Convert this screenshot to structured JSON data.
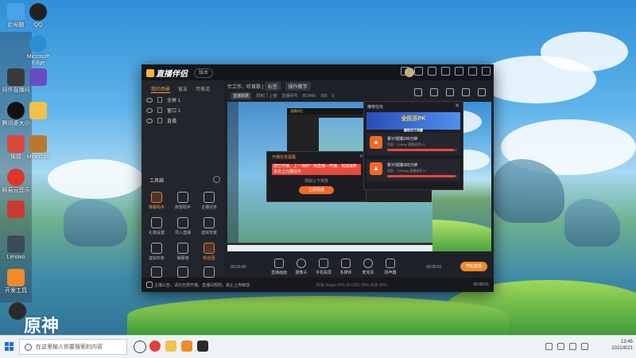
{
  "desktop": {
    "icons": [
      {
        "label": "此电脑"
      },
      {
        "label": "QQ"
      },
      {
        "label": "Microsoft Edge"
      },
      {
        "label": "同作直播间"
      },
      {
        "label": ""
      },
      {
        "label": "腾讯桌大小"
      },
      {
        "label": ""
      },
      {
        "label": "搜狐"
      },
      {
        "label": "Minecraft"
      },
      {
        "label": "网易云音乐"
      },
      {
        "label": ""
      },
      {
        "label": "Lenovo"
      },
      {
        "label": "开发工具"
      },
      {
        "label": ""
      }
    ],
    "wallpaper_logo": "原神"
  },
  "app": {
    "name": "直播伴侣",
    "version_badge": "版本",
    "left_tabs": [
      "我的场景",
      "窗友",
      "可推流"
    ],
    "scenes": [
      "全屏 1",
      "窗口 1",
      "直播"
    ],
    "tools_heading": "工具箱",
    "tools": [
      {
        "label": "弹幕助手",
        "hot": true
      },
      {
        "label": "房管助手",
        "hot": false
      },
      {
        "label": "主播任务",
        "hot": false
      },
      {
        "label": "礼物设置",
        "hot": false
      },
      {
        "label": "导入直播",
        "hot": false
      },
      {
        "label": "虚拟背景",
        "hot": false
      },
      {
        "label": "虚拟形象",
        "hot": false
      },
      {
        "label": "弹幕墙",
        "hot": false
      },
      {
        "label": "粉丝团",
        "hot": true
      },
      {
        "label": "",
        "hot": false
      },
      {
        "label": "",
        "hot": false
      },
      {
        "label": "",
        "hot": false
      }
    ],
    "info_title": "忙工作，听首歌 |",
    "info_tag": "标签",
    "info_btn": "操作教学",
    "stats": {
      "badge": "直播数据",
      "rank": "周热门 上榜",
      "id_label": "直播间号",
      "id": "852466",
      "likes": "395",
      "viewers": "0"
    },
    "task_popup": {
      "title": "推荐任务",
      "banner": "全民乐PK",
      "banner_sub": "赢取百万流量",
      "tasks": [
        {
          "name": "累计观播100分钟",
          "desc": "奖励：100exp 直播经验 x1",
          "progress": 0.95
        },
        {
          "name": "累计观播300分钟",
          "desc": "奖励：1100exp 直播经验 x1",
          "progress": 0.98
        }
      ]
    },
    "notice_popup": {
      "title": "开播任务提醒",
      "message": "您已开播，上一场的一场直播—开播，完成最新本次上元播任务",
      "sub": "领取以下奖励",
      "button": "立即完成"
    },
    "bottom_tools": [
      "直播画面",
      "摄像头",
      "手机投屏",
      "多媒体",
      "麦克风",
      "扬声器"
    ],
    "go_live": "开始直播",
    "timer_left": "00:00:00",
    "timer_right": "00:00:01",
    "status_message": "主播公告，请勿无限开播，直播间规则，禁止上传敏感",
    "status_stats": "码率 0kbps   FPS 30   CPU 28%   内存 40%"
  },
  "taskbar": {
    "search_placeholder": "在这里输入你要搜索的内容",
    "time": "13:45",
    "date": "2021/8/21"
  },
  "colors": {
    "accent": "#f08a2a",
    "panel": "#1f2128",
    "danger": "#e8493b"
  }
}
